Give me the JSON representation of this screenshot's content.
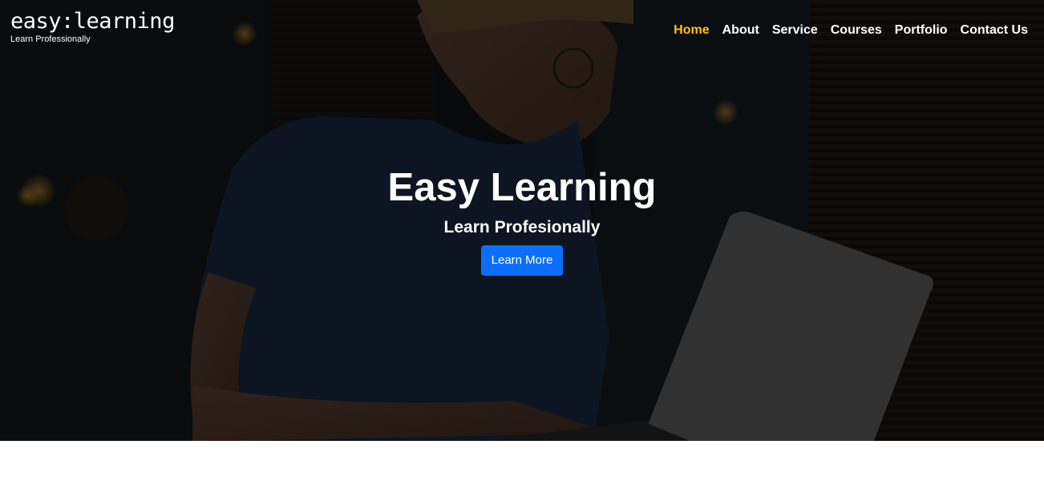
{
  "brand": {
    "name": "easy:learning",
    "tagline": "Learn Professionally"
  },
  "nav": {
    "items": [
      {
        "label": "Home",
        "active": true
      },
      {
        "label": "About"
      },
      {
        "label": "Service"
      },
      {
        "label": "Courses"
      },
      {
        "label": "Portfolio"
      },
      {
        "label": "Contact Us"
      }
    ]
  },
  "hero": {
    "title": "Easy Learning",
    "subtitle": "Learn Profesionally",
    "button_label": "Learn More",
    "image": "person-with-laptop-photo"
  },
  "colors": {
    "accent": "#ffc107",
    "button": "#0d6efd",
    "overlay": "#000000"
  }
}
